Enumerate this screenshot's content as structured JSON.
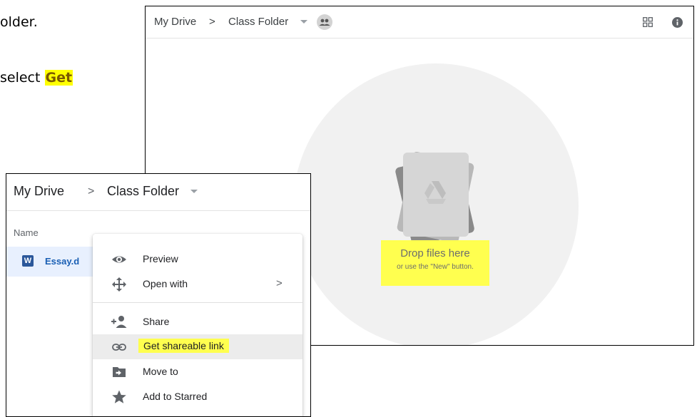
{
  "doc": {
    "line1": "older.",
    "line2_prefix": "select ",
    "line2_highlight": "Get"
  },
  "back_window": {
    "breadcrumb_root": "My Drive",
    "separator": ">",
    "breadcrumb_current": "Class Folder",
    "drop_title": "Drop files here",
    "drop_subtitle": "or use the \"New\" button.",
    "icons": [
      "chevron-right-icon",
      "dropdown-caret-icon",
      "shared-folder-icon",
      "grid-view-icon",
      "info-icon",
      "drive-logo-icon"
    ]
  },
  "front_window": {
    "breadcrumb_root": "My Drive",
    "separator": ">",
    "breadcrumb_current": "Class Folder",
    "name_header": "Name",
    "file": {
      "badge": "W",
      "name": "Essay.d"
    },
    "menu": {
      "items": [
        {
          "label": "Preview",
          "icon": "eye-icon"
        },
        {
          "label": "Open with",
          "icon": "move-arrows-icon",
          "submenu": ">"
        },
        {
          "label": "Share",
          "icon": "add-person-icon"
        },
        {
          "label": "Get shareable link",
          "icon": "link-icon"
        },
        {
          "label": "Move to",
          "icon": "move-to-folder-icon"
        },
        {
          "label": "Add to Starred",
          "icon": "star-icon"
        }
      ]
    }
  },
  "colors": {
    "highlight": "#ffff4f",
    "selected_row": "#e8f0fe",
    "word_blue": "#2b579a"
  }
}
